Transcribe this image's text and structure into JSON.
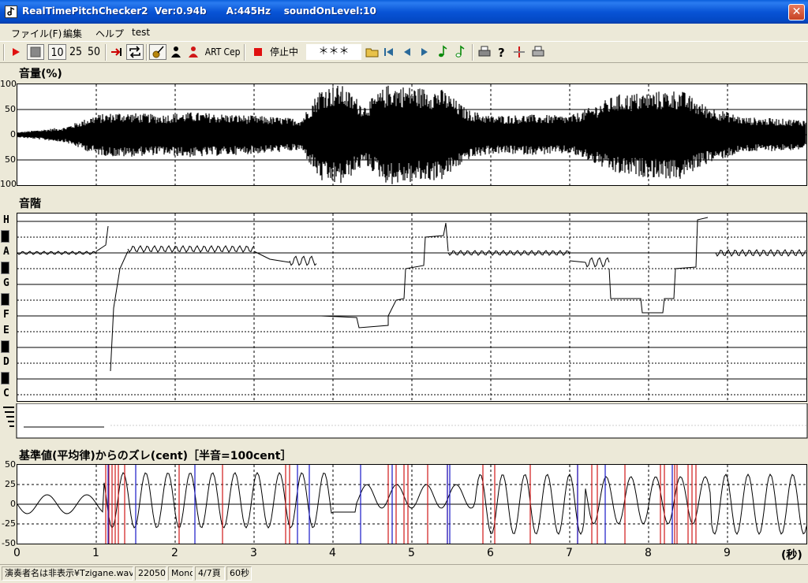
{
  "window": {
    "title": "RealTimePitchChecker2  Ver:0.94b      A:445Hz    soundOnLevel:10",
    "close_glyph": "✕"
  },
  "menu": {
    "items": [
      "ファイル(F)",
      "編集",
      "ヘルプ",
      "test"
    ]
  },
  "toolbar": {
    "zoom_options": [
      "10",
      "25",
      "50"
    ],
    "art_label": "ART",
    "cep_label": "Cep",
    "status_label": "停止中",
    "note_display": "＊＊＊"
  },
  "volume_panel": {
    "label": "音量(%)",
    "y_ticks": [
      "100",
      "50",
      "0",
      "50",
      "100"
    ]
  },
  "pitch_panel": {
    "label": "音階",
    "notes": [
      "H",
      "A",
      "G",
      "F",
      "E",
      "D",
      "C"
    ]
  },
  "deviation_panel": {
    "label": "基準値(平均律)からのズレ(cent)［半音=100cent］",
    "y_ticks": [
      "50",
      "25",
      "0",
      "-25",
      "-50"
    ]
  },
  "time_axis": {
    "ticks": [
      "0",
      "1",
      "2",
      "3",
      "4",
      "5",
      "6",
      "7",
      "8",
      "9"
    ],
    "unit": "(秒)"
  },
  "status_bar": {
    "file": "演奏者名は非表示¥Tzigane.wav",
    "sample_rate": "22050",
    "channels": "Mono",
    "page": "4/7頁",
    "duration": "60秒"
  },
  "colors": {
    "titlebar": "#0854d6",
    "red_marker": "#d01818",
    "blue_marker": "#1818c8"
  }
}
